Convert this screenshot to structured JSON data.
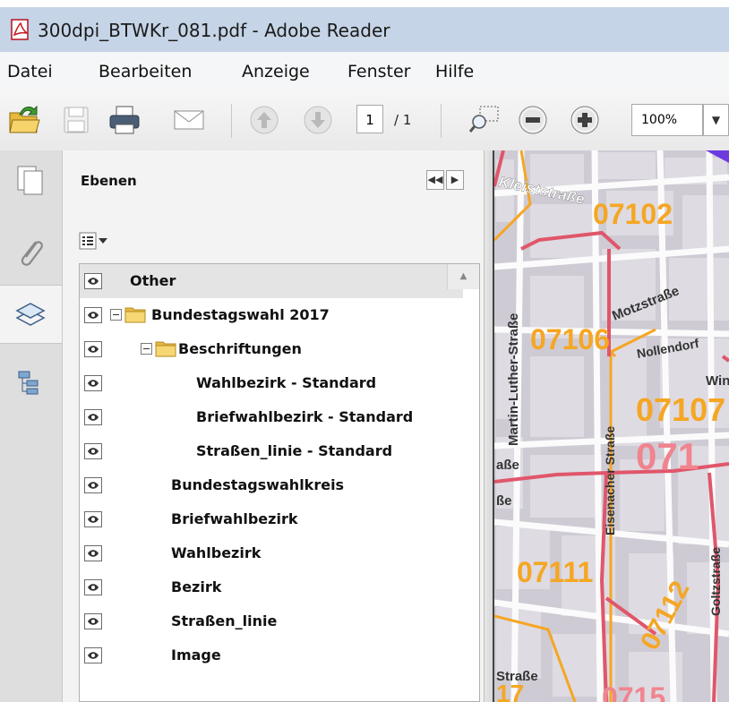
{
  "window": {
    "title": "300dpi_BTWKr_081.pdf - Adobe Reader"
  },
  "menu": [
    "Datei",
    "Bearbeiten",
    "Anzeige",
    "Fenster",
    "Hilfe"
  ],
  "toolbar": {
    "page_current": "1",
    "page_total": "/ 1",
    "zoom": "100%"
  },
  "panel": {
    "title": "Ebenen",
    "layers": [
      {
        "label": "Other",
        "indent": 0,
        "expander": false,
        "folder": false
      },
      {
        "label": "Bundestagswahl 2017",
        "indent": 0,
        "expander": true,
        "folder": true
      },
      {
        "label": "Beschriftungen",
        "indent": 1,
        "expander": true,
        "folder": true
      },
      {
        "label": "Wahlbezirk - Standard",
        "indent": 2,
        "expander": false,
        "folder": false
      },
      {
        "label": "Briefwahlbezirk - Standard",
        "indent": 2,
        "expander": false,
        "folder": false
      },
      {
        "label": "Straßen_linie - Standard",
        "indent": 2,
        "expander": false,
        "folder": false
      },
      {
        "label": "Bundestagswahlkreis",
        "indent": 1,
        "expander": false,
        "folder": false
      },
      {
        "label": "Briefwahlbezirk",
        "indent": 1,
        "expander": false,
        "folder": false
      },
      {
        "label": "Wahlbezirk",
        "indent": 1,
        "expander": false,
        "folder": false
      },
      {
        "label": "Bezirk",
        "indent": 1,
        "expander": false,
        "folder": false
      },
      {
        "label": "Straßen_linie",
        "indent": 1,
        "expander": false,
        "folder": false
      },
      {
        "label": "Image",
        "indent": 1,
        "expander": false,
        "folder": false
      }
    ]
  },
  "map": {
    "streets": [
      "Kleiststraße",
      "Martin-Luther-Straße",
      "Motzstraße",
      "Nollendorf",
      "Win",
      "Eisenacher Straße",
      "Goltzstraße",
      "aße",
      "ße",
      "Straße"
    ],
    "districts": [
      "07102",
      "07106",
      "07107",
      "071",
      "07111",
      "07112",
      "17",
      "0715"
    ],
    "colors": {
      "boundary": "#e0566a",
      "label": "#f5a623",
      "block": "#dad7dd",
      "street": "#fbfbfb"
    }
  }
}
